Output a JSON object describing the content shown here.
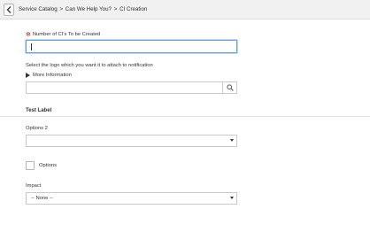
{
  "header": {
    "back_icon": "chevron-left-icon",
    "breadcrumb": [
      "Service Catalog",
      "Can We Help You?",
      "CI Creation"
    ],
    "separator": ">"
  },
  "form": {
    "num_cis": {
      "required_mark": "✻",
      "label": "Number of CI's To be Created",
      "value": ""
    },
    "logo": {
      "label": "Select the logo which you want it to attach to notification",
      "more_info": "More Information",
      "value": "",
      "search_icon": "magnifier-icon"
    },
    "section_title": "Test Label",
    "options2": {
      "label": "Options 2",
      "value": ""
    },
    "options_checkbox": {
      "label": "Options",
      "checked": false
    },
    "impact": {
      "label": "Impact",
      "value": "-- None --"
    }
  },
  "colors": {
    "required": "#c0392b",
    "focus_border": "#6aa0d8",
    "header_bg": "#f1f1f1"
  }
}
